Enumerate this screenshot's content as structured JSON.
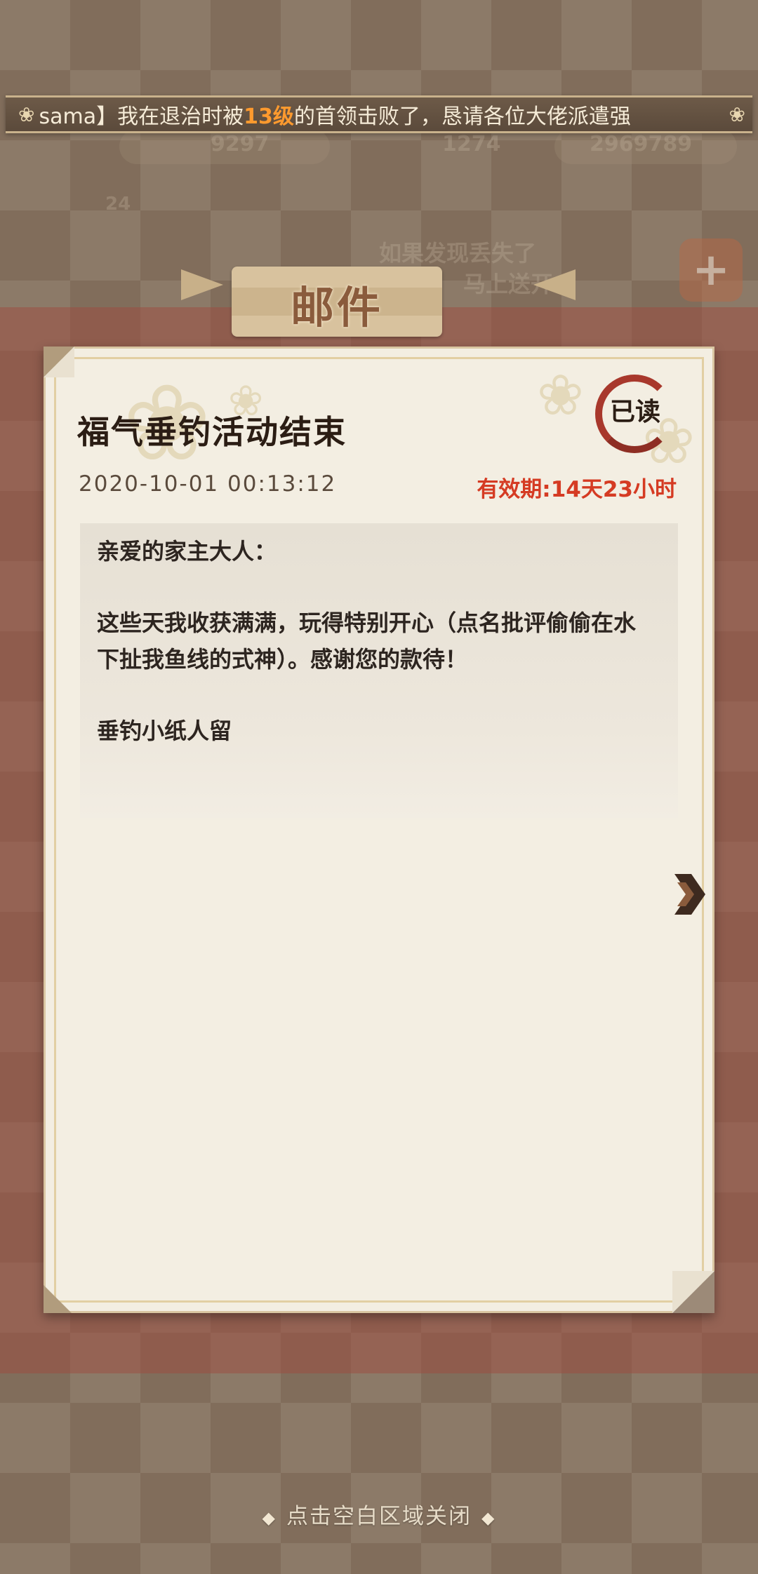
{
  "announcement": {
    "prefix": "sama】我在退治时被",
    "highlight": "13级",
    "suffix": "的首领击败了，恳请各位大佬派遣强"
  },
  "background_text": {
    "stat_left": "9297",
    "stat_mid": "1274",
    "stat_right": "2969789",
    "level": "24",
    "hint_line1": "如果发现丢失了",
    "hint_line2": "马上送开"
  },
  "panel": {
    "title": "邮件"
  },
  "mail": {
    "title": "福气垂钓活动结束",
    "status": "已读",
    "date": "2020-10-01 00:13:12",
    "expiry": "有效期:14天23小时",
    "greeting": "亲爱的家主大人：",
    "body": "这些天我收获满满，玩得特别开心（点名批评偷偷在水下扯我鱼线的式神）。感谢您的款待！",
    "signature": "垂钓小纸人留"
  },
  "footer": {
    "hint": "点击空白区域关闭"
  },
  "colors": {
    "expiry_red": "#d53b23",
    "stamp_red": "#a8382c",
    "highlight_orange": "#ff9a2e",
    "paper": "#f3eee2"
  },
  "icons": {
    "banner_left": "sakura-icon",
    "banner_right": "sakura-icon",
    "next": "chevron-right-icon",
    "stamp": "read-stamp-icon",
    "add": "plus-icon"
  }
}
